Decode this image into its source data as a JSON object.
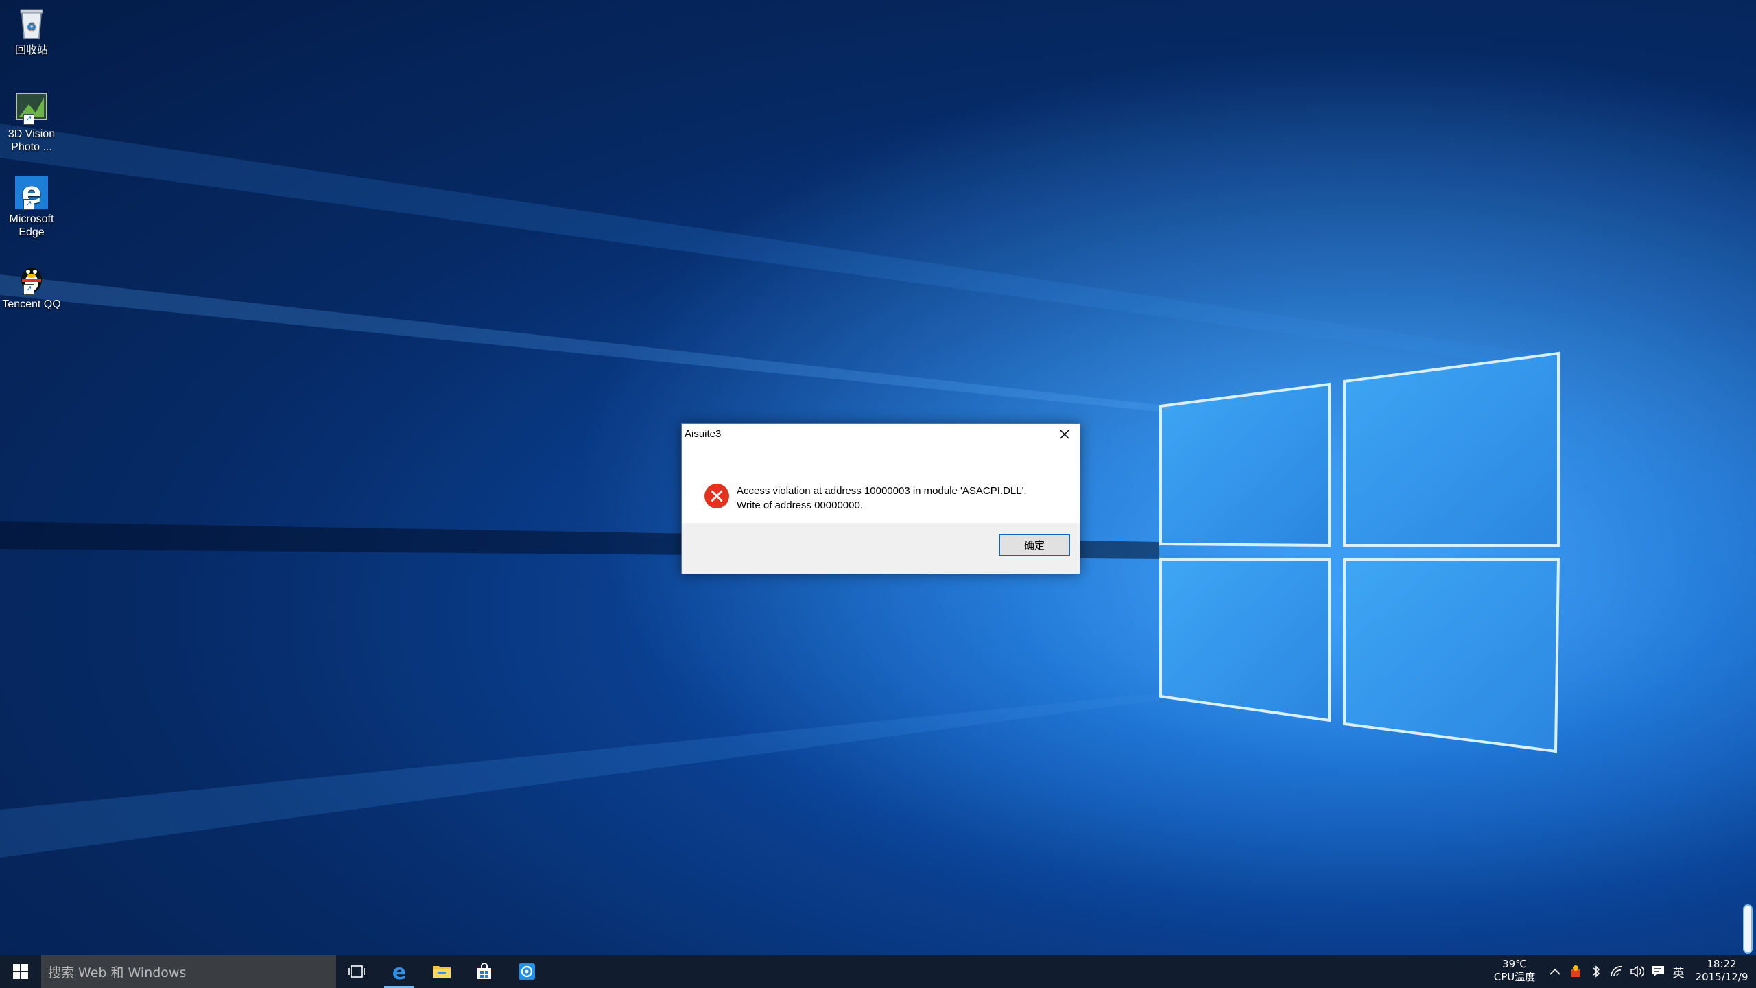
{
  "desktop": {
    "icons": [
      {
        "label_1": "回收站",
        "label_2": "",
        "icon": "recycle-bin-icon"
      },
      {
        "label_1": "3D Vision",
        "label_2": "Photo ...",
        "icon": "3d-vision-photo-icon"
      },
      {
        "label_1": "Microsoft",
        "label_2": "Edge",
        "icon": "edge-icon"
      },
      {
        "label_1": "Tencent QQ",
        "label_2": "",
        "icon": "qq-icon"
      }
    ]
  },
  "dialog": {
    "title": "Aisuite3",
    "message_line1": "Access violation at address 10000003 in module 'ASACPI.DLL'.",
    "message_line2": "Write of address 00000000.",
    "ok_label": "确定",
    "error_color": "#e5321e"
  },
  "taskbar": {
    "search_placeholder": "搜索 Web 和 Windows",
    "apps": [
      "task-view-icon",
      "edge-icon",
      "file-explorer-icon",
      "store-icon",
      "app-icon"
    ],
    "tray": {
      "temp_value": "39℃",
      "temp_label": "CPU温度",
      "ime": "英",
      "time": "18:22",
      "date": "2015/12/9"
    },
    "accent_color": "#76b9ed"
  }
}
